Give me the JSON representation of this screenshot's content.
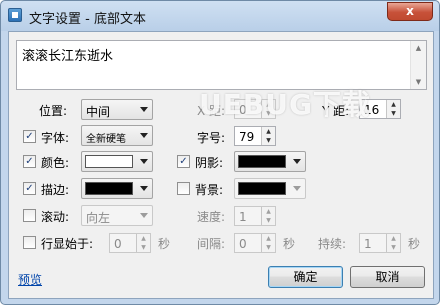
{
  "window": {
    "title": "文字设置 - 底部文本",
    "close_glyph": "x"
  },
  "text_area": {
    "value": "滚滚长江东逝水"
  },
  "position": {
    "label": "位置:",
    "value": "中间"
  },
  "x_dist": {
    "label": "X 距:",
    "value": "0"
  },
  "y_dist": {
    "label": "Y 距:",
    "value": "16"
  },
  "font": {
    "label": "字体:",
    "value": "全新硬笔",
    "checked": true
  },
  "font_size": {
    "label": "字号:",
    "value": "79"
  },
  "color": {
    "label": "颜色:",
    "checked": true,
    "swatch": "#ffffff"
  },
  "shadow": {
    "label": "阴影:",
    "checked": true,
    "swatch": "#000000"
  },
  "stroke": {
    "label": "描边:",
    "checked": true,
    "swatch": "#000000"
  },
  "background": {
    "label": "背景:",
    "checked": false,
    "swatch": "#000000"
  },
  "scroll": {
    "label": "滚动:",
    "checked": false,
    "value": "向左"
  },
  "speed": {
    "label": "速度:",
    "value": "1"
  },
  "show_at": {
    "label": "行显始于:",
    "checked": false,
    "value": "0",
    "unit": "秒"
  },
  "interval": {
    "label": "间隔:",
    "value": "0",
    "unit": "秒"
  },
  "duration": {
    "label": "持续:",
    "value": "1",
    "unit": "秒"
  },
  "buttons": {
    "preview": "预览",
    "ok": "确定",
    "cancel": "取消"
  },
  "watermark": "UEBUG下载",
  "colors": {
    "titlebar": "#c3d6ec",
    "close": "#c75139",
    "link": "#0044aa",
    "dialog_bg": "#f0f0f0"
  }
}
